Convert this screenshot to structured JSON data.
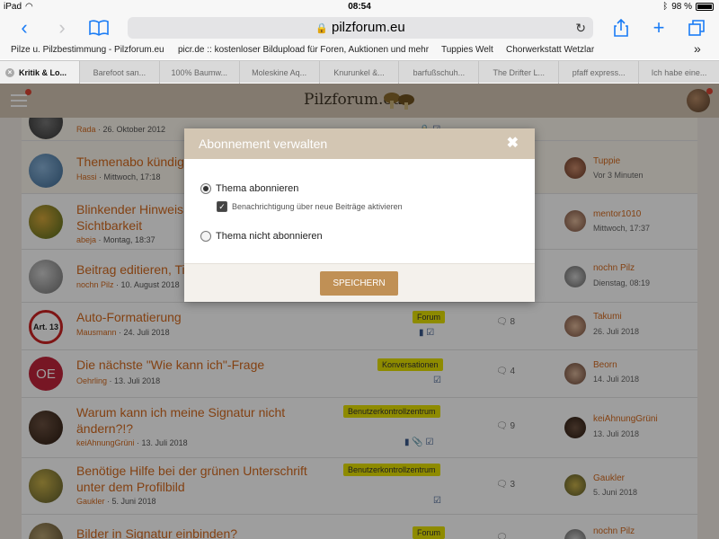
{
  "status": {
    "device": "iPad",
    "time": "08:54",
    "battery": "98 %"
  },
  "browser": {
    "url": "pilzforum.eu",
    "bookmarks": [
      "Pilze u. Pilzbestimmung - Pilzforum.eu",
      "picr.de :: kostenloser Bildupload für Foren, Auktionen und mehr",
      "Tuppies Welt",
      "Chorwerkstatt Wetzlar"
    ],
    "tabs": [
      "Kritik & Lo...",
      "Barefoot san...",
      "100% Baumw...",
      "Moleskine Aq...",
      "Knurunkel &...",
      "barfußschuh...",
      "The Drifter L...",
      "pfaff express...",
      "Ich habe eine..."
    ]
  },
  "site": {
    "logo": "Pilzforum.eu"
  },
  "threads": [
    {
      "title": "",
      "author": "Rada",
      "date": "26. Oktober 2012",
      "badge": "",
      "replies": "",
      "last_user": "",
      "last_time": ""
    },
    {
      "title": "Themenabo kündig",
      "author": "Hassi",
      "date": "Mittwoch, 17:18",
      "badge": "",
      "replies": "",
      "last_user": "Tuppie",
      "last_time": "Vor 3 Minuten"
    },
    {
      "title": "Blinkender Hinweis",
      "title2": "Sichtbarkeit",
      "author": "abeja",
      "date": "Montag, 18:37",
      "badge": "",
      "replies": "",
      "last_user": "mentor1010",
      "last_time": "Mittwoch, 17:37"
    },
    {
      "title": "Beitrag editieren, Ti",
      "author": "nochn Pilz",
      "date": "10. August 2018",
      "badge": "",
      "replies": "",
      "last_user": "nochn Pilz",
      "last_time": "Dienstag, 08:19"
    },
    {
      "title": "Auto-Formatierung",
      "author": "Mausmann",
      "date": "24. Juli 2018",
      "badge": "Forum",
      "replies": "8",
      "last_user": "Takumi",
      "last_time": "26. Juli 2018",
      "avatar_text": "Art. 13"
    },
    {
      "title": "Die nächste \"Wie kann ich\"-Frage",
      "author": "Oehrling",
      "date": "13. Juli 2018",
      "badge": "Konversationen",
      "replies": "4",
      "last_user": "Beorn",
      "last_time": "14. Juli 2018",
      "avatar_text": "OE"
    },
    {
      "title": "Warum kann ich meine Signatur nicht",
      "title2": "ändern?!?",
      "author": "keiAhnungGrüni",
      "date": "13. Juli 2018",
      "badge": "Benutzerkontrollzentrum",
      "replies": "9",
      "last_user": "keiAhnungGrüni",
      "last_time": "13. Juli 2018"
    },
    {
      "title": "Benötige Hilfe bei der grünen Unterschrift",
      "title2": "unter dem Profilbild",
      "author": "Gaukler",
      "date": "5. Juni 2018",
      "badge": "Benutzerkontrollzentrum",
      "replies": "3",
      "last_user": "Gaukler",
      "last_time": "5. Juni 2018"
    },
    {
      "title": "Bilder in Signatur einbinden?",
      "author": "",
      "date": "",
      "badge": "Forum",
      "replies": "",
      "last_user": "nochn Pilz",
      "last_time": ""
    }
  ],
  "modal": {
    "title": "Abonnement verwalten",
    "close": "✖",
    "option_subscribe": "Thema abonnieren",
    "option_notify": "Benachrichtigung über neue Beiträge aktivieren",
    "option_unsubscribe": "Thema nicht abonnieren",
    "save": "SPEICHERN"
  },
  "colors": {
    "accent": "#d46a1e",
    "header": "#d3c6b3",
    "button": "#c09055",
    "badge": "#e6e000"
  }
}
